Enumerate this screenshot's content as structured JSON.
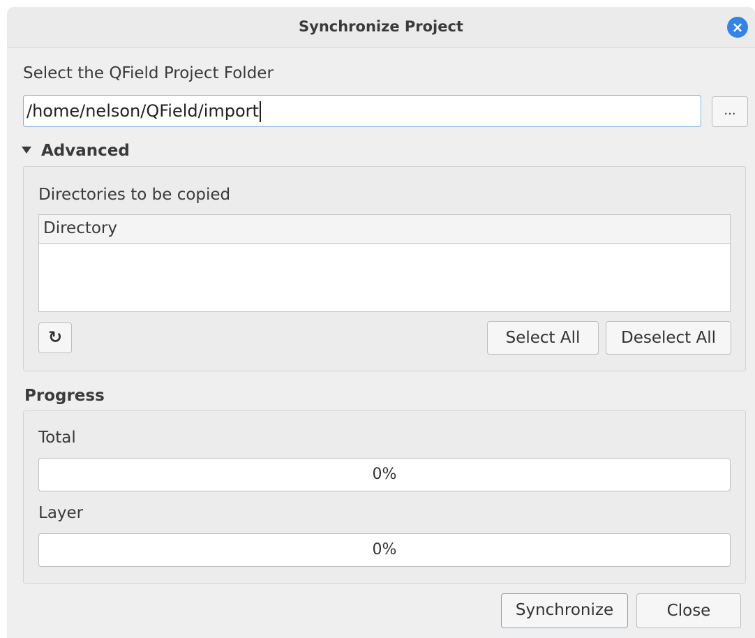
{
  "window": {
    "title": "Synchronize Project",
    "close_icon": "×"
  },
  "folder": {
    "label": "Select the QField Project Folder",
    "value": "/home/nelson/QField/import",
    "browse_label": "..."
  },
  "advanced": {
    "title": "Advanced",
    "directories_label": "Directories to be copied",
    "table_header": "Directory",
    "refresh_icon": "↻",
    "select_all": "Select All",
    "deselect_all": "Deselect All"
  },
  "progress": {
    "title": "Progress",
    "total_label": "Total",
    "total_value": "0%",
    "layer_label": "Layer",
    "layer_value": "0%"
  },
  "footer": {
    "synchronize": "Synchronize",
    "close": "Close"
  }
}
